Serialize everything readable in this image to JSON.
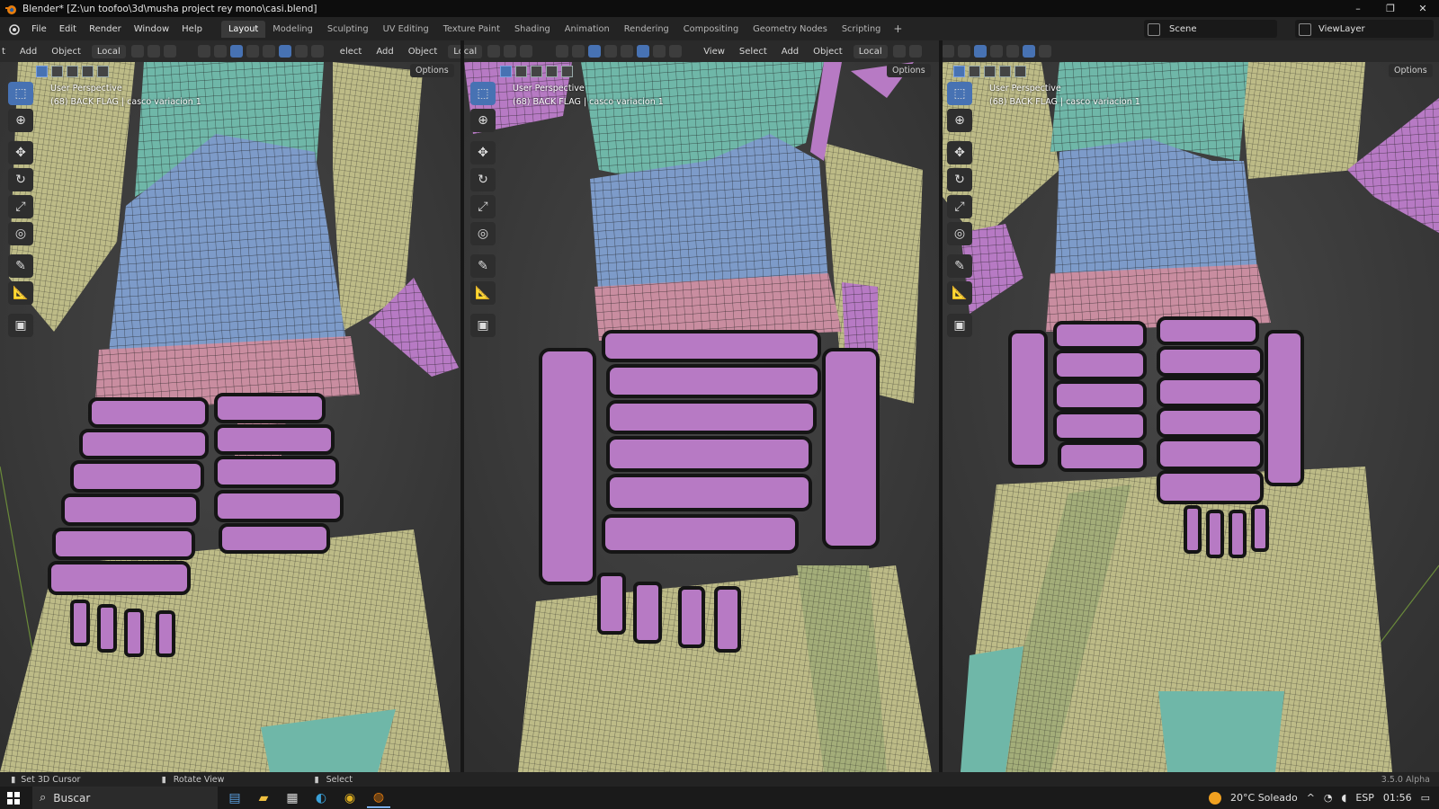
{
  "window": {
    "title": "Blender* [Z:\\un toofoo\\3d\\musha project rey mono\\casi.blend]",
    "controls": [
      "–",
      "❐",
      "✕"
    ]
  },
  "menu": [
    "File",
    "Edit",
    "Render",
    "Window",
    "Help"
  ],
  "workspaces": [
    "Layout",
    "Modeling",
    "Sculpting",
    "UV Editing",
    "Texture Paint",
    "Shading",
    "Animation",
    "Rendering",
    "Compositing",
    "Geometry Nodes",
    "Scripting"
  ],
  "active_workspace": "Layout",
  "scene": "Scene",
  "view_layer": "ViewLayer",
  "viewports": [
    {
      "header": [
        "Add",
        "Object"
      ],
      "header_prefix": "t",
      "transform": "Local",
      "options": "Options",
      "info_line1": "User Perspective",
      "info_line2": "(68) BACK FLAG | casco variacion 1"
    },
    {
      "header": [
        "Add",
        "Object"
      ],
      "header_prefix": "elect",
      "transform": "Local",
      "options": "Options",
      "info_line1": "User Perspective",
      "info_line2": "(68) BACK FLAG | casco variacion 1"
    },
    {
      "header": [
        "View",
        "Select",
        "Add",
        "Object"
      ],
      "header_prefix": "",
      "transform": "Local",
      "options": "Options",
      "info_line1": "User Perspective",
      "info_line2": "(68) BACK FLAG | casco variacion 1"
    }
  ],
  "tools": [
    "select-box",
    "cursor",
    "move",
    "rotate",
    "scale",
    "transform",
    "annotate",
    "measure",
    "add-cube"
  ],
  "status": {
    "left": "Set 3D Cursor",
    "middle": "Rotate View",
    "right": "Select",
    "version": "3.5.0 Alpha"
  },
  "taskbar": {
    "search": "Buscar",
    "weather": "20°C  Soleado",
    "lang": "ESP",
    "time": "01:56"
  },
  "colors": {
    "mesh_teal": "#6fb7a8",
    "mesh_blue": "#7d9bc9",
    "mesh_pink": "#c98da0",
    "mesh_purple": "#b77ac4",
    "mesh_cloth": "#bdbb87",
    "accent": "#4772b3"
  }
}
